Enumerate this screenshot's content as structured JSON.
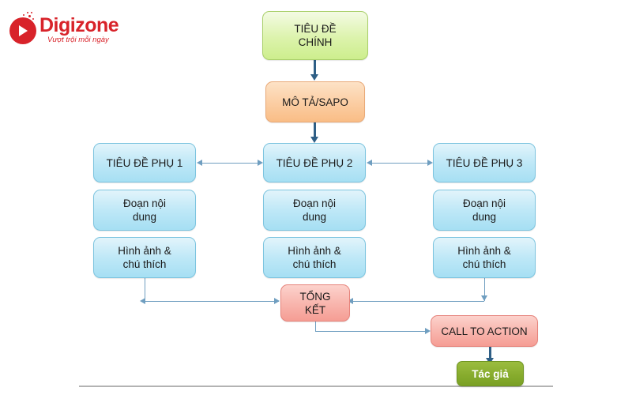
{
  "brand": {
    "name": "Digizone",
    "tagline": "Vượt trội mỗi ngày",
    "accent": "#d8232a",
    "logo_icon": "play-circle-icon"
  },
  "diagram": {
    "type": "flowchart",
    "title_node": {
      "label": "TIÊU ĐỀ\nCHÍNH",
      "line1": "TIÊU ĐỀ",
      "line2": "CHÍNH",
      "color": "#cdee8d"
    },
    "sapo_node": {
      "label": "MÔ TẢ/SAPO",
      "color": "#f9bd86"
    },
    "columns": [
      {
        "heading": "TIÊU ĐỀ PHỤ 1",
        "content_line1": "Đoạn nội",
        "content_line2": "dung",
        "image_line1": "Hình ảnh &",
        "image_line2": "chú thích",
        "color": "#a6dff3"
      },
      {
        "heading": "TIÊU ĐỀ PHỤ 2",
        "content_line1": "Đoạn nội",
        "content_line2": "dung",
        "image_line1": "Hình ảnh &",
        "image_line2": "chú thích",
        "color": "#a6dff3"
      },
      {
        "heading": "TIÊU ĐỀ PHỤ 3",
        "content_line1": "Đoạn nội",
        "content_line2": "dung",
        "image_line1": "Hình ảnh &",
        "image_line2": "chú thích",
        "color": "#a6dff3"
      }
    ],
    "summary_node": {
      "line1": "TỔNG",
      "line2": "KẾT",
      "color": "#f59d94"
    },
    "cta_node": {
      "label": "CALL TO ACTION",
      "color": "#f59d94"
    },
    "author_node": {
      "label": "Tác giả",
      "color": "#86ab2c"
    },
    "connector_color": "#6f9ec0",
    "connector_color_dark": "#2f5f86"
  }
}
